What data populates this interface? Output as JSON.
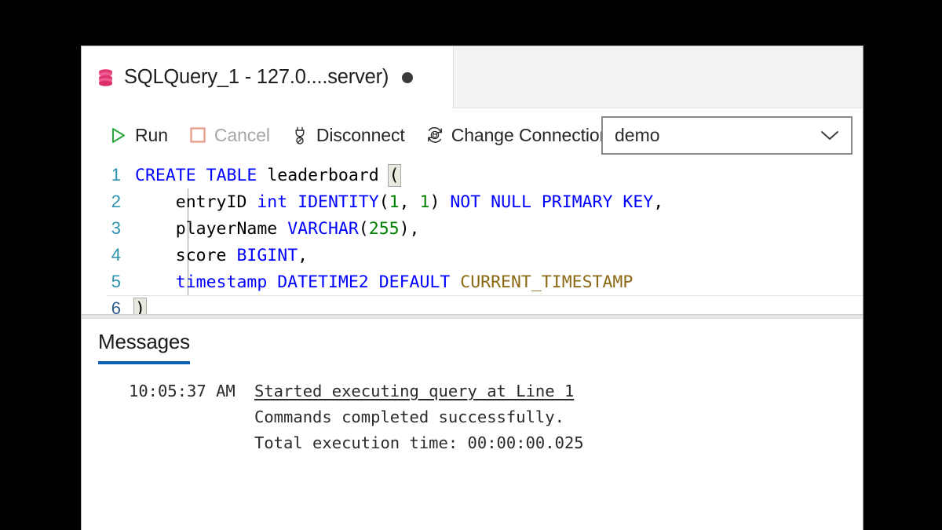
{
  "window": {
    "tab": {
      "icon": "database-icon",
      "title": "SQLQuery_1 - 127.0....server)",
      "dirty_indicator": "unsaved-dot"
    }
  },
  "toolbar": {
    "run": {
      "label": "Run",
      "icon": "play-triangle-icon",
      "color": "#2aa83a",
      "enabled": true
    },
    "cancel": {
      "label": "Cancel",
      "icon": "stop-square-icon",
      "color": "#eba08c",
      "enabled": false
    },
    "disconnect": {
      "label": "Disconnect",
      "icon": "plug-disconnect-icon",
      "enabled": true
    },
    "change_connection": {
      "label": "Change Connection",
      "icon": "refresh-connection-icon",
      "enabled": true
    },
    "connection_select": {
      "value": "demo",
      "icon": "chevron-down-icon",
      "options": [
        "demo"
      ]
    }
  },
  "editor": {
    "lines": [
      {
        "number": "1",
        "active": false
      },
      {
        "number": "2",
        "active": false
      },
      {
        "number": "3",
        "active": false
      },
      {
        "number": "4",
        "active": false
      },
      {
        "number": "5",
        "active": false
      },
      {
        "number": "6",
        "active": true
      }
    ],
    "code": {
      "l1_kw_create": "CREATE",
      "l1_kw_table": "TABLE",
      "l1_name": "leaderboard",
      "l1_paren": "(",
      "l2_col": "entryID",
      "l2_type": "int",
      "l2_identity": "IDENTITY",
      "l2_n1": "1",
      "l2_n2": "1",
      "l2_notnull": "NOT NULL PRIMARY KEY",
      "l3_col": "playerName",
      "l3_type": "VARCHAR",
      "l3_len": "255",
      "l4_col": "score",
      "l4_type": "BIGINT",
      "l5_col": "timestamp",
      "l5_type": "DATETIME2",
      "l5_default": "DEFAULT",
      "l5_func": "CURRENT_TIMESTAMP",
      "l6_paren": ")"
    },
    "plain_text": "CREATE TABLE leaderboard (\n    entryID int IDENTITY(1, 1) NOT NULL PRIMARY KEY,\n    playerName VARCHAR(255),\n    score BIGINT,\n    timestamp DATETIME2 DEFAULT CURRENT_TIMESTAMP\n)"
  },
  "results_panel": {
    "tab_label": "Messages",
    "accent_color": "#0b62b5",
    "rows": [
      {
        "time": "10:05:37 AM",
        "text": "Started executing query at Line 1",
        "link": true
      },
      {
        "time": "",
        "text": "Commands completed successfully.",
        "link": false
      },
      {
        "time": "",
        "text": "Total execution time: 00:00:00.025",
        "link": false
      }
    ]
  }
}
